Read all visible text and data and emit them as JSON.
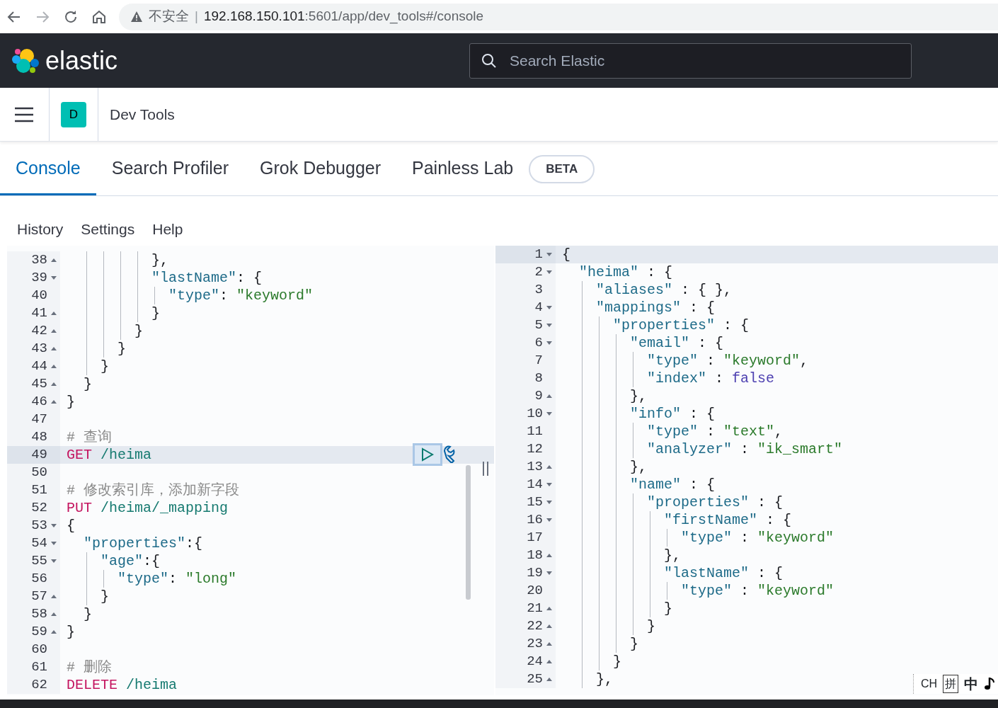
{
  "browser": {
    "security_warning": "不安全",
    "separator": "|",
    "url_host": "192.168.150.101",
    "url_rest": ":5601/app/dev_tools#/console"
  },
  "header": {
    "brand": "elastic",
    "search": {
      "placeholder": "Search Elastic"
    }
  },
  "breadcrumb": {
    "space_badge": "D",
    "title": "Dev Tools"
  },
  "tabs": [
    {
      "label": "Console",
      "selected": true
    },
    {
      "label": "Search Profiler",
      "selected": false
    },
    {
      "label": "Grok Debugger",
      "selected": false
    },
    {
      "label": "Painless Lab",
      "selected": false,
      "badge": "BETA"
    }
  ],
  "menu": [
    "History",
    "Settings",
    "Help"
  ],
  "request_editor": {
    "lines": [
      {
        "number": "38",
        "fold_end": true,
        "active": false,
        "tokens": [
          {
            "kind": "punct",
            "text": "          },"
          }
        ]
      },
      {
        "number": "39",
        "fold_start": true,
        "active": false,
        "tokens": [
          {
            "kind": "key",
            "text": "          \"lastName\""
          },
          {
            "kind": "punct",
            "text": ": {"
          }
        ]
      },
      {
        "number": "40",
        "active": false,
        "tokens": [
          {
            "kind": "key",
            "text": "            \"type\""
          },
          {
            "kind": "punct",
            "text": ": "
          },
          {
            "kind": "string",
            "text": "\"keyword\""
          }
        ]
      },
      {
        "number": "41",
        "fold_end": true,
        "active": false,
        "tokens": [
          {
            "kind": "punct",
            "text": "          }"
          }
        ]
      },
      {
        "number": "42",
        "fold_end": true,
        "active": false,
        "tokens": [
          {
            "kind": "punct",
            "text": "        }"
          }
        ]
      },
      {
        "number": "43",
        "fold_end": true,
        "active": false,
        "tokens": [
          {
            "kind": "punct",
            "text": "      }"
          }
        ]
      },
      {
        "number": "44",
        "fold_end": true,
        "active": false,
        "tokens": [
          {
            "kind": "punct",
            "text": "    }"
          }
        ]
      },
      {
        "number": "45",
        "fold_end": true,
        "active": false,
        "tokens": [
          {
            "kind": "punct",
            "text": "  }"
          }
        ]
      },
      {
        "number": "46",
        "fold_end": true,
        "active": false,
        "tokens": [
          {
            "kind": "punct",
            "text": "}"
          }
        ]
      },
      {
        "number": "47",
        "active": false
      },
      {
        "number": "48",
        "active": false,
        "tokens": [
          {
            "kind": "comment",
            "text": "# 查询"
          }
        ]
      },
      {
        "number": "49",
        "active": true,
        "tokens": [
          {
            "kind": "method",
            "text": "GET"
          },
          {
            "kind": "path",
            "text": " /heima"
          }
        ]
      },
      {
        "number": "50",
        "active": false
      },
      {
        "number": "51",
        "active": false,
        "tokens": [
          {
            "kind": "comment",
            "text": "# 修改索引库，添加新字段"
          }
        ]
      },
      {
        "number": "52",
        "active": false,
        "tokens": [
          {
            "kind": "method",
            "text": "PUT"
          },
          {
            "kind": "path",
            "text": " /heima/_mapping"
          }
        ]
      },
      {
        "number": "53",
        "fold_start": true,
        "active": false,
        "tokens": [
          {
            "kind": "punct",
            "text": "{"
          }
        ]
      },
      {
        "number": "54",
        "fold_start": true,
        "active": false,
        "tokens": [
          {
            "kind": "key",
            "text": "  \"properties\""
          },
          {
            "kind": "punct",
            "text": ":{"
          }
        ]
      },
      {
        "number": "55",
        "fold_start": true,
        "active": false,
        "tokens": [
          {
            "kind": "key",
            "text": "    \"age\""
          },
          {
            "kind": "punct",
            "text": ":{"
          }
        ]
      },
      {
        "number": "56",
        "active": false,
        "tokens": [
          {
            "kind": "key",
            "text": "      \"type\""
          },
          {
            "kind": "punct",
            "text": ": "
          },
          {
            "kind": "string",
            "text": "\"long\""
          }
        ]
      },
      {
        "number": "57",
        "fold_end": true,
        "active": false,
        "tokens": [
          {
            "kind": "punct",
            "text": "    }"
          }
        ]
      },
      {
        "number": "58",
        "fold_end": true,
        "active": false,
        "tokens": [
          {
            "kind": "punct",
            "text": "  }"
          }
        ]
      },
      {
        "number": "59",
        "fold_end": true,
        "active": false,
        "tokens": [
          {
            "kind": "punct",
            "text": "}"
          }
        ]
      },
      {
        "number": "60",
        "active": false
      },
      {
        "number": "61",
        "active": false,
        "tokens": [
          {
            "kind": "comment",
            "text": "# 删除"
          }
        ]
      },
      {
        "number": "62",
        "active": false,
        "tokens": [
          {
            "kind": "method",
            "text": "DELETE"
          },
          {
            "kind": "path",
            "text": " /heima"
          }
        ]
      }
    ]
  },
  "response_viewer": {
    "lines": [
      {
        "number": "1",
        "fold_start": true,
        "active": true,
        "tokens": [
          {
            "kind": "punct",
            "text": "{"
          }
        ]
      },
      {
        "number": "2",
        "fold_start": true,
        "active": false,
        "tokens": [
          {
            "kind": "key",
            "text": "  \"heima\""
          },
          {
            "kind": "punct",
            "text": " : {"
          }
        ]
      },
      {
        "number": "3",
        "active": false,
        "tokens": [
          {
            "kind": "key",
            "text": "    \"aliases\""
          },
          {
            "kind": "punct",
            "text": " : { },"
          }
        ]
      },
      {
        "number": "4",
        "fold_start": true,
        "active": false,
        "tokens": [
          {
            "kind": "key",
            "text": "    \"mappings\""
          },
          {
            "kind": "punct",
            "text": " : {"
          }
        ]
      },
      {
        "number": "5",
        "fold_start": true,
        "active": false,
        "tokens": [
          {
            "kind": "key",
            "text": "      \"properties\""
          },
          {
            "kind": "punct",
            "text": " : {"
          }
        ]
      },
      {
        "number": "6",
        "fold_start": true,
        "active": false,
        "tokens": [
          {
            "kind": "key",
            "text": "        \"email\""
          },
          {
            "kind": "punct",
            "text": " : {"
          }
        ]
      },
      {
        "number": "7",
        "active": false,
        "tokens": [
          {
            "kind": "key",
            "text": "          \"type\""
          },
          {
            "kind": "punct",
            "text": " : "
          },
          {
            "kind": "string",
            "text": "\"keyword\""
          },
          {
            "kind": "punct",
            "text": ","
          }
        ]
      },
      {
        "number": "8",
        "active": false,
        "tokens": [
          {
            "kind": "key",
            "text": "          \"index\""
          },
          {
            "kind": "punct",
            "text": " : "
          },
          {
            "kind": "boolean",
            "text": "false"
          }
        ]
      },
      {
        "number": "9",
        "fold_end": true,
        "active": false,
        "tokens": [
          {
            "kind": "punct",
            "text": "        },"
          }
        ]
      },
      {
        "number": "10",
        "fold_start": true,
        "active": false,
        "tokens": [
          {
            "kind": "key",
            "text": "        \"info\""
          },
          {
            "kind": "punct",
            "text": " : {"
          }
        ]
      },
      {
        "number": "11",
        "active": false,
        "tokens": [
          {
            "kind": "key",
            "text": "          \"type\""
          },
          {
            "kind": "punct",
            "text": " : "
          },
          {
            "kind": "string",
            "text": "\"text\""
          },
          {
            "kind": "punct",
            "text": ","
          }
        ]
      },
      {
        "number": "12",
        "active": false,
        "tokens": [
          {
            "kind": "key",
            "text": "          \"analyzer\""
          },
          {
            "kind": "punct",
            "text": " : "
          },
          {
            "kind": "string",
            "text": "\"ik_smart\""
          }
        ]
      },
      {
        "number": "13",
        "fold_end": true,
        "active": false,
        "tokens": [
          {
            "kind": "punct",
            "text": "        },"
          }
        ]
      },
      {
        "number": "14",
        "fold_start": true,
        "active": false,
        "tokens": [
          {
            "kind": "key",
            "text": "        \"name\""
          },
          {
            "kind": "punct",
            "text": " : {"
          }
        ]
      },
      {
        "number": "15",
        "fold_start": true,
        "active": false,
        "tokens": [
          {
            "kind": "key",
            "text": "          \"properties\""
          },
          {
            "kind": "punct",
            "text": " : {"
          }
        ]
      },
      {
        "number": "16",
        "fold_start": true,
        "active": false,
        "tokens": [
          {
            "kind": "key",
            "text": "            \"firstName\""
          },
          {
            "kind": "punct",
            "text": " : {"
          }
        ]
      },
      {
        "number": "17",
        "active": false,
        "tokens": [
          {
            "kind": "key",
            "text": "              \"type\""
          },
          {
            "kind": "punct",
            "text": " : "
          },
          {
            "kind": "string",
            "text": "\"keyword\""
          }
        ]
      },
      {
        "number": "18",
        "fold_end": true,
        "active": false,
        "tokens": [
          {
            "kind": "punct",
            "text": "            },"
          }
        ]
      },
      {
        "number": "19",
        "fold_start": true,
        "active": false,
        "tokens": [
          {
            "kind": "key",
            "text": "            \"lastName\""
          },
          {
            "kind": "punct",
            "text": " : {"
          }
        ]
      },
      {
        "number": "20",
        "active": false,
        "tokens": [
          {
            "kind": "key",
            "text": "              \"type\""
          },
          {
            "kind": "punct",
            "text": " : "
          },
          {
            "kind": "string",
            "text": "\"keyword\""
          }
        ]
      },
      {
        "number": "21",
        "fold_end": true,
        "active": false,
        "tokens": [
          {
            "kind": "punct",
            "text": "            }"
          }
        ]
      },
      {
        "number": "22",
        "fold_end": true,
        "active": false,
        "tokens": [
          {
            "kind": "punct",
            "text": "          }"
          }
        ]
      },
      {
        "number": "23",
        "fold_end": true,
        "active": false,
        "tokens": [
          {
            "kind": "punct",
            "text": "        }"
          }
        ]
      },
      {
        "number": "24",
        "fold_end": true,
        "active": false,
        "tokens": [
          {
            "kind": "punct",
            "text": "      }"
          }
        ]
      },
      {
        "number": "25",
        "fold_end": true,
        "active": false,
        "tokens": [
          {
            "kind": "punct",
            "text": "    },"
          }
        ]
      }
    ]
  },
  "ime_bar": [
    "CH",
    "拼",
    "中"
  ]
}
